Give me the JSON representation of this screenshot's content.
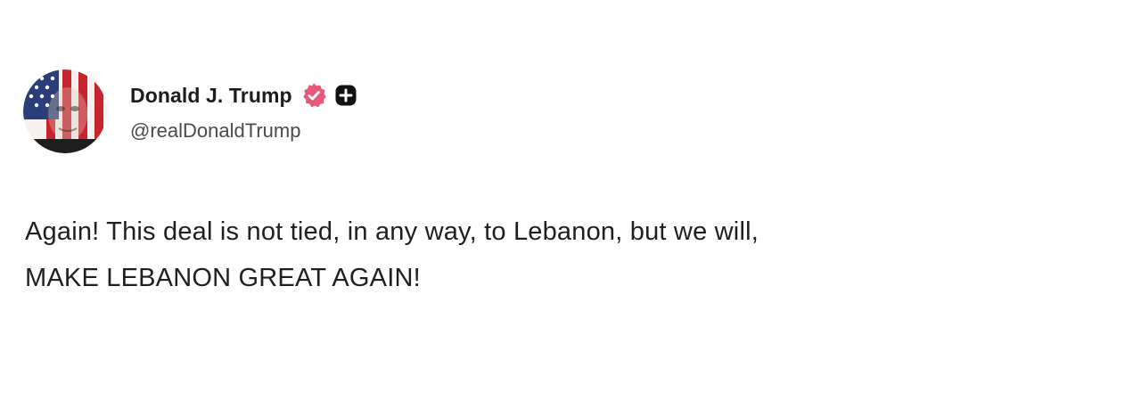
{
  "post": {
    "author": {
      "display_name": "Donald J. Trump",
      "handle": "@realDonaldTrump",
      "avatar_icon": "american-flag-portrait-avatar",
      "badges": [
        "verified-badge-icon",
        "plus-icon"
      ],
      "badge_color": "#e8587a"
    },
    "text_lines": [
      "Again! This deal is not tied, in any way, to Lebanon, but we will,",
      "MAKE LEBANON GREAT AGAIN!"
    ]
  }
}
